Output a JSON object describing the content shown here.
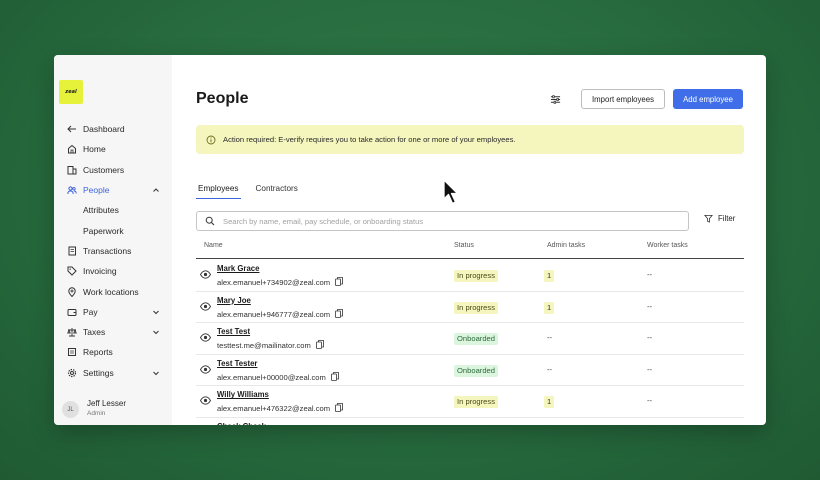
{
  "app": {
    "logo_text": "zeal"
  },
  "sidebar": {
    "items": [
      {
        "label": "Dashboard",
        "icon": "arrow-left-icon"
      },
      {
        "label": "Home",
        "icon": "home-icon"
      },
      {
        "label": "Customers",
        "icon": "building-icon"
      },
      {
        "label": "People",
        "icon": "people-icon",
        "active": true
      },
      {
        "label": "Attributes"
      },
      {
        "label": "Paperwork"
      },
      {
        "label": "Transactions",
        "icon": "receipt-icon"
      },
      {
        "label": "Invoicing",
        "icon": "tag-icon"
      },
      {
        "label": "Work locations",
        "icon": "pin-icon"
      },
      {
        "label": "Pay",
        "icon": "wallet-icon"
      },
      {
        "label": "Taxes",
        "icon": "scale-icon"
      },
      {
        "label": "Reports",
        "icon": "report-icon"
      },
      {
        "label": "Settings",
        "icon": "gear-icon"
      }
    ],
    "user": {
      "initials": "JL",
      "name": "Jeff Lesser",
      "role": "Admin"
    }
  },
  "header": {
    "title": "People",
    "import_label": "Import employees",
    "add_label": "Add employee"
  },
  "alert": {
    "text": "Action required: E-verify requires you to take action for one or more of your employees."
  },
  "tabs": [
    {
      "label": "Employees",
      "active": true
    },
    {
      "label": "Contractors"
    }
  ],
  "search": {
    "placeholder": "Search by name, email, pay schedule, or onboarding status",
    "value": ""
  },
  "filter_label": "Filter",
  "table": {
    "columns": [
      "Name",
      "Status",
      "Admin tasks",
      "Worker tasks"
    ],
    "rows": [
      {
        "name": "Mark Grace",
        "email": "alex.emanuel+734902@zeal.com",
        "status": "In progress",
        "admin_tasks": "1",
        "worker_tasks": "--"
      },
      {
        "name": "Mary Joe",
        "email": "alex.emanuel+946777@zeal.com",
        "status": "In progress",
        "admin_tasks": "1",
        "worker_tasks": "--"
      },
      {
        "name": "Test Test",
        "email": "testtest.me@mailinator.com",
        "status": "Onboarded",
        "admin_tasks": "--",
        "worker_tasks": "--"
      },
      {
        "name": "Test Tester",
        "email": "alex.emanuel+00000@zeal.com",
        "status": "Onboarded",
        "admin_tasks": "--",
        "worker_tasks": "--"
      },
      {
        "name": "Willy Williams",
        "email": "alex.emanuel+476322@zeal.com",
        "status": "In progress",
        "admin_tasks": "1",
        "worker_tasks": "--"
      },
      {
        "name": "Check Check",
        "email": "",
        "status": "",
        "admin_tasks": "",
        "worker_tasks": ""
      }
    ]
  },
  "colors": {
    "accent": "#3f6ee8",
    "alert_bg": "#f4f6bd",
    "onboarded_bg": "#dcf5df",
    "background": "#276b3e"
  }
}
